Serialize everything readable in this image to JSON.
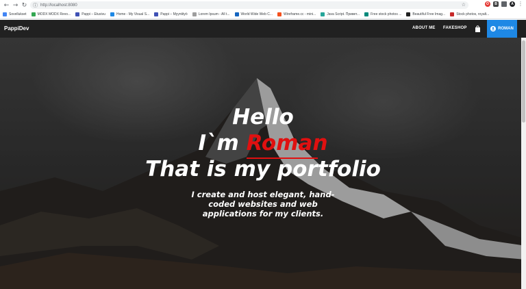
{
  "browser": {
    "url": "http://localhost:8080",
    "bookmarks": [
      {
        "label": "Sovellukset",
        "color": "#4285f4"
      },
      {
        "label": "MODX MODX Revo...",
        "color": "#34a853"
      },
      {
        "label": "Pappi – Etusivu",
        "color": "#3f51b5"
      },
      {
        "label": "Home - My Visual S...",
        "color": "#1e88e5"
      },
      {
        "label": "Pappi – Myyntityö",
        "color": "#3f51b5"
      },
      {
        "label": "Lorem Ipsum - All t...",
        "color": "#9e9e9e"
      },
      {
        "label": "World Wide Web C...",
        "color": "#1565c0"
      },
      {
        "label": "Wireframe.cc - mini...",
        "color": "#f4511e"
      },
      {
        "label": "Java Script. Привет...",
        "color": "#26a69a"
      },
      {
        "label": "Free stock photos ...",
        "color": "#00897b"
      },
      {
        "label": "Beautiful Free Imag...",
        "color": "#212121"
      },
      {
        "label": "Stock photos, royalt...",
        "color": "#c62828"
      }
    ]
  },
  "navbar": {
    "brand": "PappiDev",
    "links": [
      "ABOUT ME",
      "FAKESHOP"
    ],
    "user_label": "ROMAN",
    "accent": "#1e88e5"
  },
  "hero": {
    "line1": "Hello",
    "line2_prefix": "I`m ",
    "line2_name": "Roman",
    "line3": "That is my portfolio",
    "subtitle": "I create and host elegant, hand-coded websites and web applications for my clients.",
    "name_color": "#e01010"
  }
}
